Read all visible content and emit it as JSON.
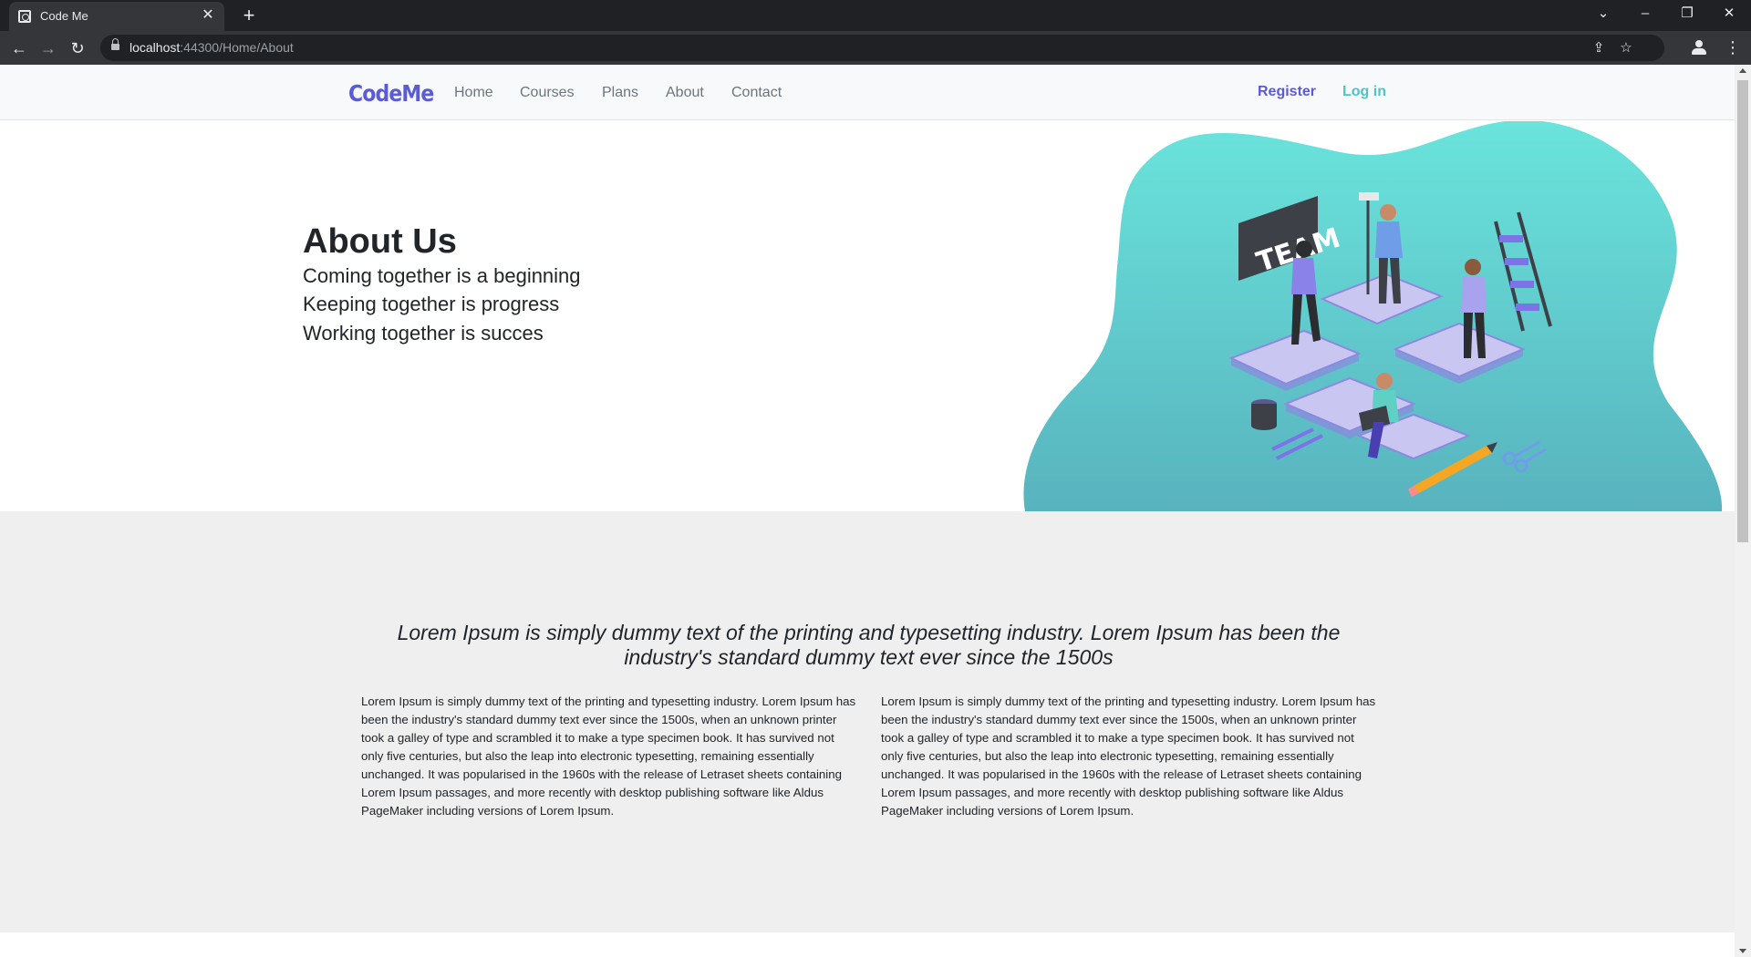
{
  "browser": {
    "tab_title": "Code Me",
    "url_host": "localhost",
    "url_rest": ":44300/Home/About"
  },
  "navbar": {
    "brand": "CodeMe",
    "links": [
      "Home",
      "Courses",
      "Plans",
      "About",
      "Contact"
    ],
    "register": "Register",
    "login": "Log in"
  },
  "hero": {
    "title": "About Us",
    "lines": [
      "Coming together is a beginning",
      "Keeping together is progress",
      "Working together is succes"
    ],
    "illustration_sign": "TEAM"
  },
  "lorem": {
    "lead": "Lorem Ipsum is simply dummy text of the printing and typesetting industry. Lorem Ipsum has been the industry's standard dummy text ever since the 1500s",
    "col_left": "Lorem Ipsum is simply dummy text of the printing and typesetting industry. Lorem Ipsum has been the industry's standard dummy text ever since the 1500s, when an unknown printer took a galley of type and scrambled it to make a type specimen book. It has survived not only five centuries, but also the leap into electronic typesetting, remaining essentially unchanged. It was popularised in the 1960s with the release of Letraset sheets containing Lorem Ipsum passages, and more recently with desktop publishing software like Aldus PageMaker including versions of Lorem Ipsum.",
    "col_right": "Lorem Ipsum is simply dummy text of the printing and typesetting industry. Lorem Ipsum has been the industry's standard dummy text ever since the 1500s, when an unknown printer took a galley of type and scrambled it to make a type specimen book. It has survived not only five centuries, but also the leap into electronic typesetting, remaining essentially unchanged. It was popularised in the 1960s with the release of Letraset sheets containing Lorem Ipsum passages, and more recently with desktop publishing software like Aldus PageMaker including versions of Lorem Ipsum."
  },
  "colors": {
    "brand": "#5b5bd6",
    "accent": "#4fc3c8",
    "section_bg": "#efefef"
  },
  "icons": [
    "favicon-icon",
    "close-icon",
    "plus-icon",
    "chevron-down-icon",
    "minimize-icon",
    "restore-icon",
    "back-arrow-icon",
    "forward-arrow-icon",
    "reload-icon",
    "lock-icon",
    "share-icon",
    "star-icon",
    "profile-icon",
    "kebab-menu-icon"
  ]
}
